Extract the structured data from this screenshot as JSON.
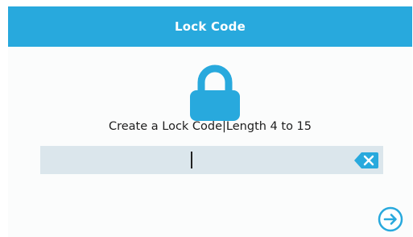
{
  "header": {
    "title": "Lock Code"
  },
  "main": {
    "lock_icon": "lock-icon",
    "prompt": "Create a Lock Code|Length 4 to 15",
    "code_input": {
      "value": "",
      "placeholder": ""
    },
    "backspace_icon": "backspace-icon",
    "next_icon": "arrow-right-circle-icon"
  },
  "colors": {
    "accent": "#28a9dd",
    "field_background": "#dbe6ec",
    "background": "#fbfcfc"
  }
}
